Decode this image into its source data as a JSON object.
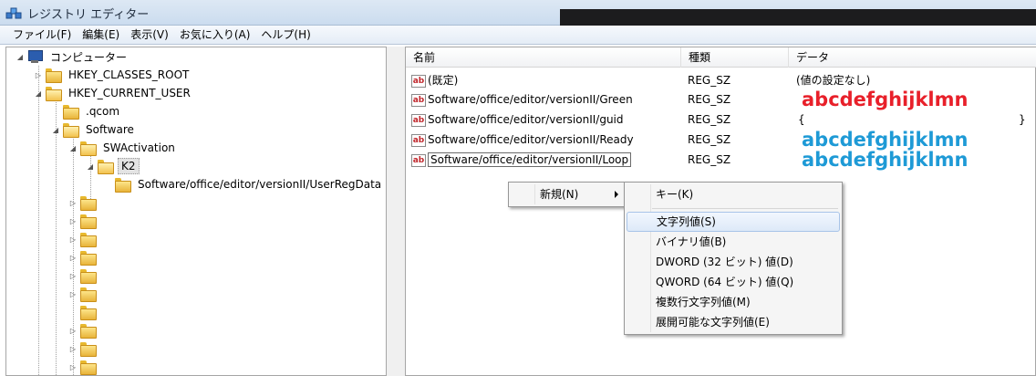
{
  "window": {
    "title": "レジストリ エディター"
  },
  "menubar": [
    "ファイル(F)",
    "編集(E)",
    "表示(V)",
    "お気に入り(A)",
    "ヘルプ(H)"
  ],
  "tree": {
    "computer": "コンピューター",
    "hkcr": "HKEY_CLASSES_ROOT",
    "hkcu": "HKEY_CURRENT_USER",
    "qcom": ".qcom",
    "software": "Software",
    "swactivation": "SWActivation",
    "k2": "K2",
    "userregdata": "Software/office/editor/versionII/UserRegData"
  },
  "list": {
    "headers": {
      "name": "名前",
      "type": "種類",
      "data": "データ"
    },
    "rows": [
      {
        "name": "(既定)",
        "type": "REG_SZ",
        "data": "(値の設定なし)"
      },
      {
        "name": "Software/office/editor/versionII/Green",
        "type": "REG_SZ",
        "data": "abcdefghijklmn"
      },
      {
        "name": "Software/office/editor/versionII/guid",
        "type": "REG_SZ",
        "data": "{",
        "data_end": "}"
      },
      {
        "name": "Software/office/editor/versionII/Ready",
        "type": "REG_SZ",
        "data": "abcdefghijklmn"
      },
      {
        "name": "Software/office/editor/versionII/Loop",
        "type": "REG_SZ",
        "data": "abcdefghijklmn"
      }
    ]
  },
  "context_menu": {
    "new": "新規(N)"
  },
  "submenu": {
    "key": "キー(K)",
    "string": "文字列値(S)",
    "binary": "バイナリ値(B)",
    "dword": "DWORD (32 ビット) 値(D)",
    "qword": "QWORD (64 ビット) 値(Q)",
    "multi": "複数行文字列値(M)",
    "expand": "展開可能な文字列値(E)"
  },
  "colors": {
    "red_value": "#e8202a",
    "blue_value": "#1e9ad6"
  }
}
